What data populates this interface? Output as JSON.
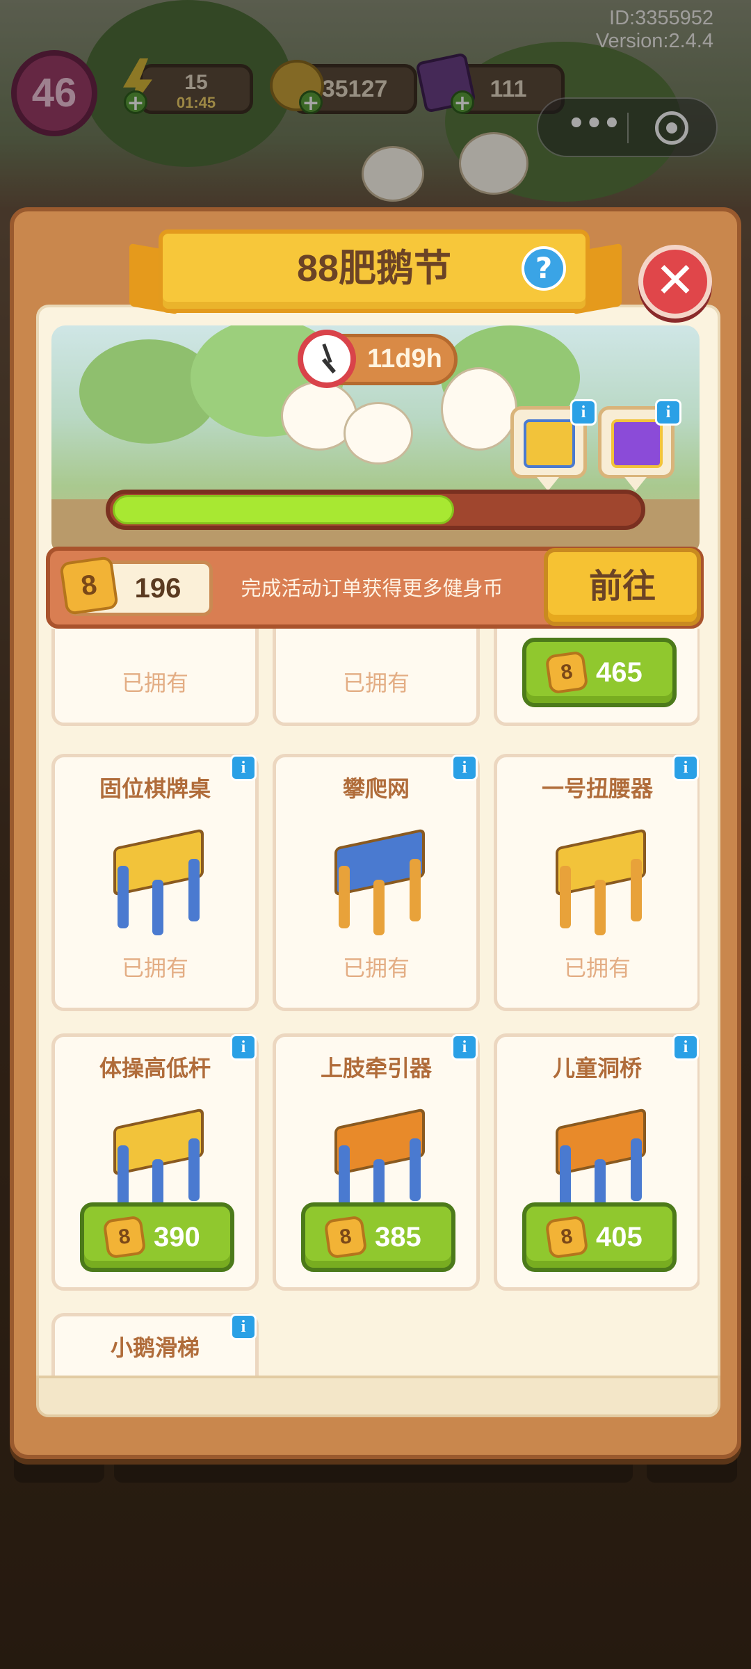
{
  "hud": {
    "id_text": "ID:3355952",
    "version_text": "Version:2.4.4",
    "level": "46",
    "energy": "15",
    "energy_timer": "01:45",
    "coins": "35127",
    "gems": "111"
  },
  "panel": {
    "title": "88肥鹅节",
    "help": "?",
    "close": "✕",
    "timer": "11d9h",
    "progress_fraction": 0.65,
    "coin_count": "196",
    "coin_symbol": "8",
    "coin_desc": "完成活动订单获得更多健身币",
    "goto_label": "前往",
    "info_glyph": "i"
  },
  "items": [
    {
      "name": "",
      "status": "已拥有",
      "price": null
    },
    {
      "name": "",
      "status": "已拥有",
      "price": null
    },
    {
      "name": "",
      "status": "",
      "price": "465"
    },
    {
      "name": "固位棋牌桌",
      "status": "已拥有",
      "price": null
    },
    {
      "name": "攀爬网",
      "status": "已拥有",
      "price": null
    },
    {
      "name": "一号扭腰器",
      "status": "已拥有",
      "price": null
    },
    {
      "name": "体操高低杆",
      "status": "",
      "price": "390"
    },
    {
      "name": "上肢牵引器",
      "status": "",
      "price": "385"
    },
    {
      "name": "儿童洞桥",
      "status": "",
      "price": "405"
    },
    {
      "name": "小鹅滑梯",
      "status": "",
      "price": null
    }
  ],
  "colors": {
    "panel": "#c9874d",
    "banner": "#f7c73a",
    "buy_green": "#90c82e",
    "progress": "#a8e832",
    "info_blue": "#2aa0e6",
    "close_red": "#e0464a"
  }
}
